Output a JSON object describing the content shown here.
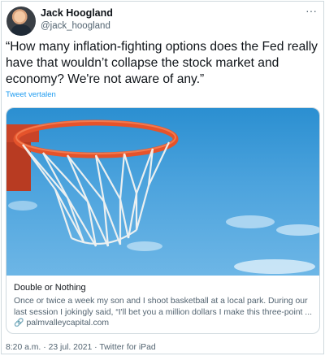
{
  "author": {
    "name": "Jack Hoogland",
    "handle": "@jack_hoogland"
  },
  "more_glyph": "···",
  "tweet": {
    "text": "“How many inflation-fighting options does the Fed really have that wouldn’t collapse the stock market and economy? We're not aware of any.”",
    "translate_label": "Tweet vertalen"
  },
  "card": {
    "title": "Double or Nothing",
    "description": "Once or twice a week my son and I shoot basketball at a local park. During our last session I jokingly said, “I'll bet you a million dollars I make this three-point ...",
    "domain": "palmvalleycapital.com",
    "image_icon": "basketball-hoop-image"
  },
  "meta": {
    "time": "8:20 a.m.",
    "separator": " · ",
    "date": "23 jul. 2021",
    "source": "Twitter for iPad"
  },
  "colors": {
    "link": "#1d9bf0",
    "secondary_text": "#536471",
    "border": "#cfd9de",
    "rim": "#e5532b",
    "sky": "#4ca3dd"
  }
}
